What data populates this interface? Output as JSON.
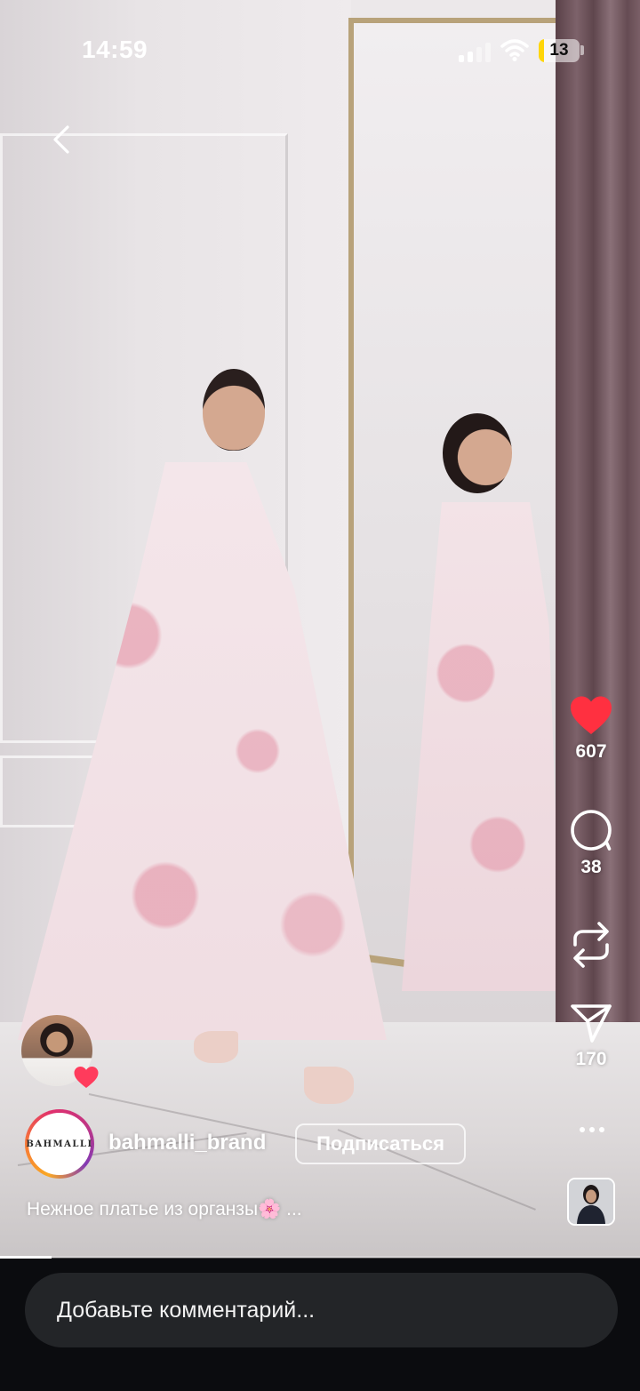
{
  "status_bar": {
    "time": "14:59",
    "battery_level": "13",
    "battery_fraction": 0.13,
    "battery_color": "#ffd60a"
  },
  "nav": {
    "back_icon": "chevron-left-icon"
  },
  "actions": {
    "like": {
      "icon": "heart-filled-icon",
      "count": "607",
      "color": "#ff3040"
    },
    "comment": {
      "icon": "comment-bubble-icon",
      "count": "38"
    },
    "repost": {
      "icon": "repost-icon"
    },
    "share": {
      "icon": "send-icon",
      "count": "170"
    },
    "more": {
      "icon": "more-dots-icon"
    },
    "audio": {
      "icon": "audio-thumbnail"
    }
  },
  "post": {
    "author": {
      "username": "bahmalli_brand",
      "avatar_logo": "BAHMALLI"
    },
    "follow_label": "Подписаться",
    "caption_text": "Нежное платье из органзы",
    "caption_emoji": "🌸",
    "caption_more": "...",
    "tagged_user_badge": "heart-icon"
  },
  "video_progress": 0.08,
  "comment_bar": {
    "placeholder": "Добавьте комментарий..."
  }
}
